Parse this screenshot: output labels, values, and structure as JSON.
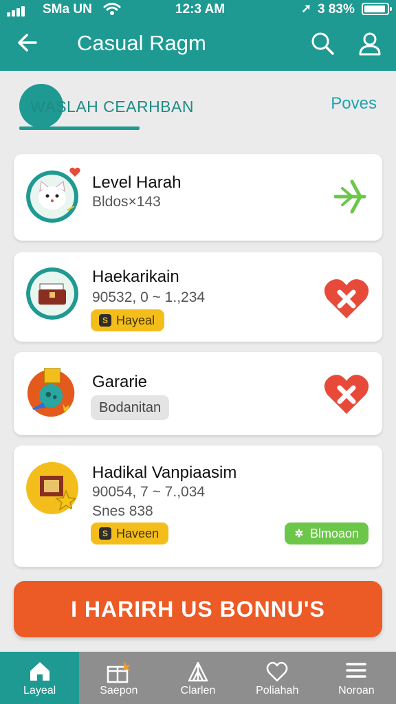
{
  "status": {
    "carrier": "SMa UN",
    "time": "12:3 AM",
    "battery": "3 83%"
  },
  "header": {
    "title": "Casual Ragm"
  },
  "section": {
    "label": "WASLAH CEARHBAN",
    "link": "Poves"
  },
  "cards": [
    {
      "title": "Level Harah",
      "subtitle": "Bldos×143"
    },
    {
      "title": "Haekarikain",
      "subtitle": "90532, 0 ~ 1.,234",
      "tag": "Hayeal"
    },
    {
      "title": "Gararie",
      "tag": "Bodanitan"
    },
    {
      "title": "Hadikal Vanpiaasim",
      "subtitle": "90054, 7 ~ 7.,034",
      "meta": "Snes 838",
      "tag": "Haveen",
      "tag2": "Blmoaon"
    }
  ],
  "cta": {
    "label": "I HARIRH US BONNU'S"
  },
  "nav": [
    {
      "label": "Layeal",
      "icon": "home-icon",
      "active": true
    },
    {
      "label": "Saepon",
      "icon": "gift-icon"
    },
    {
      "label": "Clarlen",
      "icon": "tent-icon"
    },
    {
      "label": "Poliahah",
      "icon": "heart-icon"
    },
    {
      "label": "Noroan",
      "icon": "menu-icon"
    }
  ],
  "colors": {
    "primary": "#1e9a92",
    "accent": "#ec5a26",
    "favorite": "#e84a3a",
    "tag_yellow": "#f3be1c",
    "tag_green": "#6cc64a"
  }
}
